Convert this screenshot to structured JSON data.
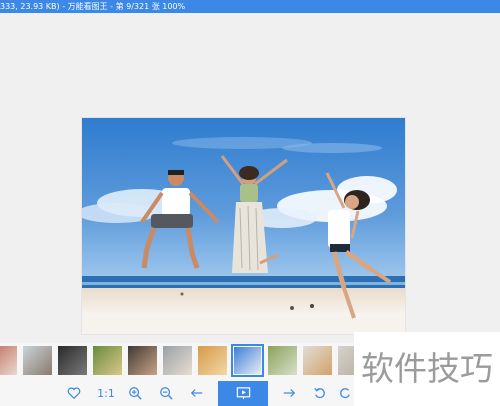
{
  "window": {
    "title": "333, 23.93 KB) - 万能看图王 - 第 9/321 张 100%"
  },
  "filmstrip": {
    "thumbnails": [
      {
        "color_a": "#c06a5a",
        "color_b": "#e8d9cf"
      },
      {
        "color_a": "#c9d4d8",
        "color_b": "#8a7a6e"
      },
      {
        "color_a": "#2a2a2a",
        "color_b": "#7a7a7a"
      },
      {
        "color_a": "#6b8a3e",
        "color_b": "#d8c98a"
      },
      {
        "color_a": "#3f3a34",
        "color_b": "#c8a487"
      },
      {
        "color_a": "#9aa0a6",
        "color_b": "#e6ded2"
      },
      {
        "color_a": "#d79a4a",
        "color_b": "#f2d7a4"
      },
      {
        "color_a": "#3c7fd6",
        "color_b": "#e8eef5"
      },
      {
        "color_a": "#8aa35c",
        "color_b": "#d8dfc8"
      },
      {
        "color_a": "#e1ddd7",
        "color_b": "#d2a36a"
      },
      {
        "color_a": "#d6d2ca",
        "color_b": "#b5ae9f"
      }
    ],
    "selected_index": 7
  },
  "toolbar": {
    "favorite_icon": "heart-icon",
    "actual_size_label": "1:1",
    "zoom_in_icon": "zoom-in-icon",
    "zoom_out_icon": "zoom-out-icon",
    "prev_icon": "arrow-left-icon",
    "slideshow_icon": "slideshow-icon",
    "next_icon": "arrow-right-icon",
    "rotate_icon": "rotate-left-icon"
  },
  "overlay": {
    "watermark_text": "软件技巧"
  },
  "colors": {
    "accent": "#3b88e6",
    "sky_top": "#2f7ccf",
    "sky_bottom": "#7fb3e3",
    "sea": "#2d6fb3",
    "sand": "#f1ece4"
  }
}
